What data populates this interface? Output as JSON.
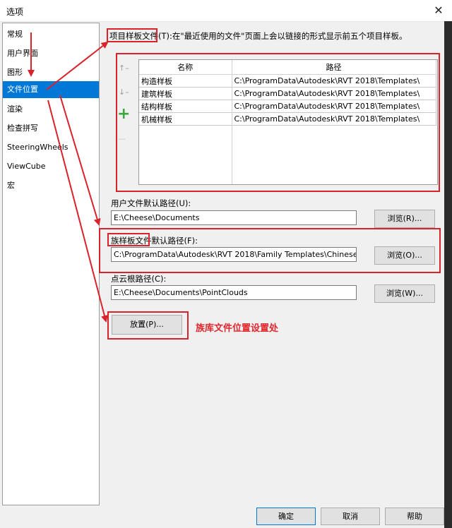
{
  "window": {
    "title": "选项",
    "close_glyph": "✕"
  },
  "sidebar": {
    "items": [
      {
        "label": "常规"
      },
      {
        "label": "用户界面"
      },
      {
        "label": "图形"
      },
      {
        "label": "文件位置"
      },
      {
        "label": "渲染"
      },
      {
        "label": "检查拼写"
      },
      {
        "label": "SteeringWheels"
      },
      {
        "label": "ViewCube"
      },
      {
        "label": "宏"
      }
    ],
    "selected_index": 3
  },
  "templates": {
    "label_prefix": "项目样板文件",
    "label_rest": "(T):在\"最近使用的文件\"页面上会以链接的形式显示前五个项目样板。",
    "columns": [
      "名称",
      "路径"
    ],
    "rows": [
      {
        "name": "构造样板",
        "path": "C:\\ProgramData\\Autodesk\\RVT 2018\\Templates\\"
      },
      {
        "name": "建筑样板",
        "path": "C:\\ProgramData\\Autodesk\\RVT 2018\\Templates\\"
      },
      {
        "name": "结构样板",
        "path": "C:\\ProgramData\\Autodesk\\RVT 2018\\Templates\\"
      },
      {
        "name": "机械样板",
        "path": "C:\\ProgramData\\Autodesk\\RVT 2018\\Templates\\"
      }
    ],
    "tools": {
      "up": "↑–",
      "down": "↓–",
      "add": "+",
      "remove": "—"
    },
    "add_color": "#3fa33f"
  },
  "user_path": {
    "label": "用户文件默认路径(U):",
    "value": "E:\\Cheese\\Documents",
    "browse": "浏览(R)..."
  },
  "family_path": {
    "label_prefix": "族样板文件",
    "label_rest": "默认路径(F):",
    "value": "C:\\ProgramData\\Autodesk\\RVT 2018\\Family Templates\\Chinese",
    "browse": "浏览(O)..."
  },
  "cloud_path": {
    "label": "点云根路径(C):",
    "value": "E:\\Cheese\\Documents\\PointClouds",
    "browse": "浏览(W)..."
  },
  "places_button": "放置(P)...",
  "annotation": "族库文件位置设置处",
  "footer": {
    "ok": "确定",
    "cancel": "取消",
    "help": "帮助"
  },
  "colors": {
    "selection": "#0078d7",
    "annotation_red": "#d9232a"
  }
}
